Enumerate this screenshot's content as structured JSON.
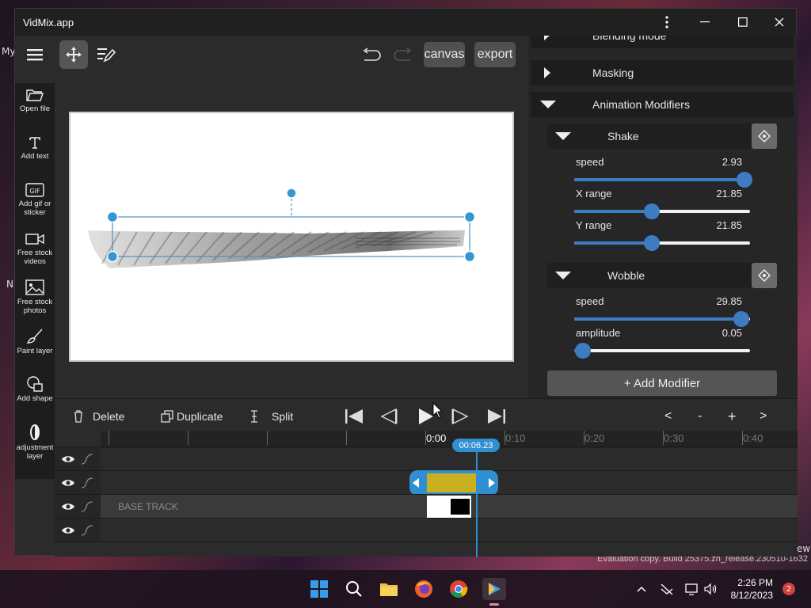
{
  "desktop": {
    "left_label_1": "My",
    "left_label_2": "N",
    "right_label": "ew",
    "evaluation_text": "Evaluation copy. Build 25375.zn_release.230510-1632"
  },
  "window": {
    "title": "VidMix.app",
    "menu_icon": "kebab-menu-icon",
    "minimize_icon": "minimize-icon",
    "maximize_icon": "maximize-icon",
    "close_icon": "close-icon"
  },
  "toolbar": {
    "canvas_label": "canvas",
    "export_label": "export"
  },
  "tools": [
    {
      "label": "Open file",
      "icon": "folder-icon"
    },
    {
      "label": "Add text",
      "icon": "text-icon"
    },
    {
      "label": "Add gif or sticker",
      "icon": "gif-icon"
    },
    {
      "label": "Free stock videos",
      "icon": "video-camera-icon"
    },
    {
      "label": "Free stock photos",
      "icon": "image-icon"
    },
    {
      "label": "Paint layer",
      "icon": "brush-icon"
    },
    {
      "label": "Add shape",
      "icon": "shape-icon"
    },
    {
      "label": "adjustment layer",
      "icon": "adjustment-icon"
    }
  ],
  "panel": {
    "sections": [
      {
        "label": "Blending mode",
        "expanded": false
      },
      {
        "label": "Masking",
        "expanded": false
      },
      {
        "label": "Animation Modifiers",
        "expanded": true
      }
    ],
    "modifiers": [
      {
        "name": "Shake",
        "params": [
          {
            "label": "speed",
            "value": "2.93",
            "fraction": 0.97
          },
          {
            "label": "X range",
            "value": "21.85",
            "fraction": 0.44
          },
          {
            "label": "Y range",
            "value": "21.85",
            "fraction": 0.44
          }
        ]
      },
      {
        "name": "Wobble",
        "params": [
          {
            "label": "speed",
            "value": "29.85",
            "fraction": 0.95
          },
          {
            "label": "amplitude",
            "value": "0.05",
            "fraction": 0.05
          }
        ]
      }
    ],
    "add_modifier_label": "+ Add Modifier"
  },
  "timeline": {
    "delete_label": "Delete",
    "duplicate_label": "Duplicate",
    "split_label": "Split",
    "zoom_prev": "<",
    "zoom_out": "-",
    "zoom_in": "+",
    "zoom_next": ">",
    "ruler_labels": [
      "0:00",
      "0:10",
      "0:20",
      "0:30",
      "0:40"
    ],
    "playhead_time": "00:06.23",
    "base_track_label": "BASE TRACK"
  },
  "taskbar": {
    "time": "2:26 PM",
    "date": "8/12/2023",
    "notifications": "2",
    "accent": "#3e7cc2"
  }
}
